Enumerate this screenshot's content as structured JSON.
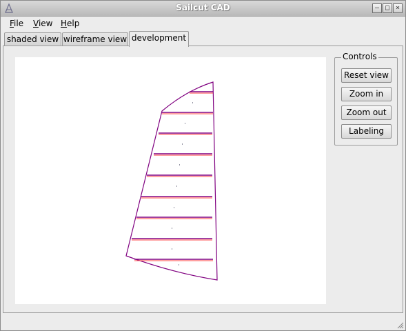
{
  "window": {
    "title": "Sailcut CAD"
  },
  "menu": [
    {
      "label": "File",
      "accel": "F",
      "rest": "ile"
    },
    {
      "label": "View",
      "accel": "V",
      "rest": "iew"
    },
    {
      "label": "Help",
      "accel": "H",
      "rest": "elp"
    }
  ],
  "tabs": [
    {
      "label": "shaded view",
      "active": false
    },
    {
      "label": "wireframe view",
      "active": false
    },
    {
      "label": "development",
      "active": true
    }
  ],
  "controls": {
    "title": "Controls",
    "buttons": [
      "Reset view",
      "Zoom in",
      "Zoom out",
      "Labeling"
    ]
  },
  "colors": {
    "panel_edge": "#800080",
    "seam": "#ff0000",
    "background": "#ececec",
    "canvas": "#ffffff"
  }
}
